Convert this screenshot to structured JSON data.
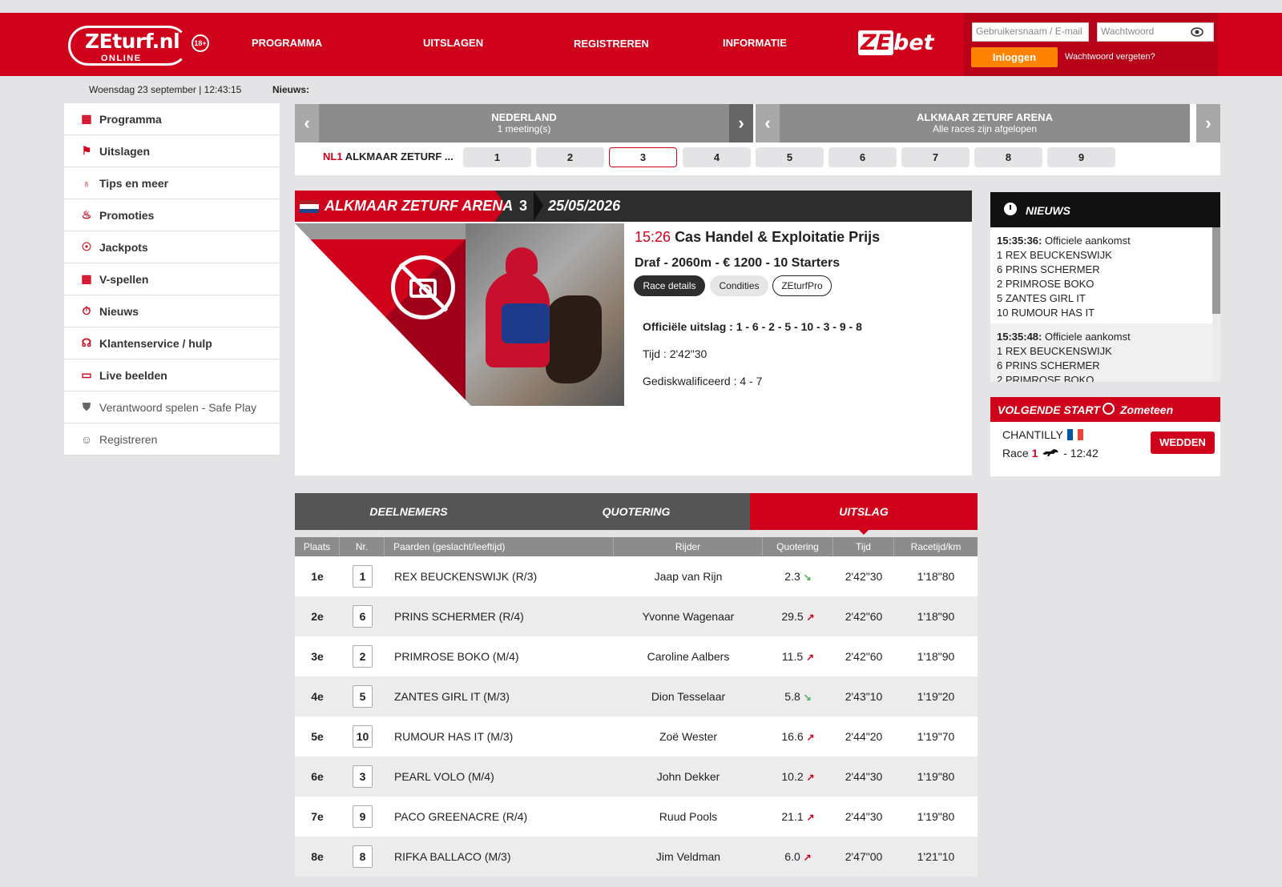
{
  "header": {
    "logo_text": "ZEturf.nl",
    "logo_sub": "ONLINE",
    "age": "18+",
    "nav": [
      "PROGRAMMA",
      "UITSLAGEN",
      "REGISTREREN",
      "INFORMATIE"
    ],
    "zebet_ze": "ZE",
    "zebet_bet": "bet",
    "login": {
      "username_placeholder": "Gebruikersnaam / E-mail",
      "password_placeholder": "Wachtwoord",
      "login_label": "Inloggen",
      "forgot_label": "Wachtwoord vergeten?"
    }
  },
  "datebar": {
    "date": "Woensdag 23 september | 12:43:15",
    "news_label": "Nieuws:"
  },
  "sidebar": {
    "items": [
      {
        "label": "Programma",
        "icon": "calendar-icon"
      },
      {
        "label": "Uitslagen",
        "icon": "flag-icon"
      },
      {
        "label": "Tips en meer",
        "icon": "bulb-icon"
      },
      {
        "label": "Promoties",
        "icon": "fire-icon"
      },
      {
        "label": "Jackpots",
        "icon": "money-bag-icon"
      },
      {
        "label": "V-spellen",
        "icon": "grid-icon"
      },
      {
        "label": "Nieuws",
        "icon": "stopwatch-icon"
      },
      {
        "label": "Klantenservice / hulp",
        "icon": "headset-icon"
      },
      {
        "label": "Live beelden",
        "icon": "monitor-icon"
      },
      {
        "label": "Verantwoord spelen - Safe Play",
        "icon": "shield-icon"
      },
      {
        "label": "Registreren",
        "icon": "user-icon"
      }
    ]
  },
  "meeting": {
    "country": "NEDERLAND",
    "country_sub": "1 meeting(s)",
    "venue": "ALKMAAR ZETURF ARENA",
    "venue_sub": "Alle races zijn afgelopen",
    "code": "NL1",
    "label": "ALKMAAR ZETURF ...",
    "races": [
      "1",
      "2",
      "3",
      "4",
      "5",
      "6",
      "7",
      "8",
      "9"
    ],
    "active_race": "3"
  },
  "race": {
    "venue": "ALKMAAR ZETURF ARENA",
    "number": "3",
    "date": "25/05/2026",
    "time": "15:26",
    "name": "Cas Handel & Exploitatie Prijs",
    "subtitle": "Draf - 2060m - € 1200 - 10 Starters",
    "buttons": [
      "Race details",
      "Condities",
      "ZEturfPro"
    ],
    "official": "Officiële uitslag : 1 - 6 - 2 - 5 - 10 - 3 - 9 - 8",
    "tijd": "Tijd : 2'42\"30",
    "dq": "Gediskwalificeerd : 4 - 7"
  },
  "tabs": [
    "DEELNEMERS",
    "QUOTERING",
    "UITSLAG"
  ],
  "table": {
    "headers": [
      "Plaats",
      "Nr.",
      "Paarden (geslacht/leeftijd)",
      "Rijder",
      "Quotering",
      "Tijd",
      "Racetijd/km"
    ],
    "rows": [
      {
        "plaats": "1e",
        "nr": "1",
        "paard": "REX BEUCKENSWIJK (R/3)",
        "rijder": "Jaap van Rijn",
        "quot": "2.3",
        "trend": "down",
        "tijd": "2'42\"30",
        "km": "1'18\"80"
      },
      {
        "plaats": "2e",
        "nr": "6",
        "paard": "PRINS SCHERMER (R/4)",
        "rijder": "Yvonne Wagenaar",
        "quot": "29.5",
        "trend": "up",
        "tijd": "2'42\"60",
        "km": "1'18\"90"
      },
      {
        "plaats": "3e",
        "nr": "2",
        "paard": "PRIMROSE BOKO (M/4)",
        "rijder": "Caroline Aalbers",
        "quot": "11.5",
        "trend": "up",
        "tijd": "2'42\"60",
        "km": "1'18\"90"
      },
      {
        "plaats": "4e",
        "nr": "5",
        "paard": "ZANTES GIRL IT (M/3)",
        "rijder": "Dion Tesselaar",
        "quot": "5.8",
        "trend": "down",
        "tijd": "2'43\"10",
        "km": "1'19\"20"
      },
      {
        "plaats": "5e",
        "nr": "10",
        "paard": "RUMOUR HAS IT (M/3)",
        "rijder": "Zoë Wester",
        "quot": "16.6",
        "trend": "up",
        "tijd": "2'44\"20",
        "km": "1'19\"70"
      },
      {
        "plaats": "6e",
        "nr": "3",
        "paard": "PEARL VOLO (M/4)",
        "rijder": "John Dekker",
        "quot": "10.2",
        "trend": "up",
        "tijd": "2'44\"30",
        "km": "1'19\"80"
      },
      {
        "plaats": "7e",
        "nr": "9",
        "paard": "PACO GREENACRE (R/4)",
        "rijder": "Ruud Pools",
        "quot": "21.1",
        "trend": "up",
        "tijd": "2'44\"30",
        "km": "1'19\"80"
      },
      {
        "plaats": "8e",
        "nr": "8",
        "paard": "RIFKA BALLACO (M/3)",
        "rijder": "Jim Veldman",
        "quot": "6.0",
        "trend": "up",
        "tijd": "2'47\"00",
        "km": "1'21\"10"
      }
    ]
  },
  "news": {
    "title": "NIEUWS",
    "entries": [
      {
        "time": "15:35:36:",
        "text": "Officiele aankomst",
        "lines": [
          "1 REX BEUCKENSWIJK",
          "6 PRINS SCHERMER",
          "2 PRIMROSE BOKO",
          "5 ZANTES GIRL IT",
          "10 RUMOUR HAS IT"
        ]
      },
      {
        "time": "15:35:48:",
        "text": "Officiele aankomst",
        "lines": [
          "1 REX BEUCKENSWIJK",
          "6 PRINS SCHERMER",
          "2 PRIMROSE BOKO"
        ]
      }
    ]
  },
  "next": {
    "title": "VOLGENDE START",
    "when": "Zometeen",
    "venue": "CHANTILLY",
    "race_label": "Race",
    "race_num": "1",
    "time": "- 12:42",
    "button": "WEDDEN"
  },
  "colors": {
    "brand_red": "#d0021b",
    "login_orange": "#ff8200",
    "dark": "#2d2d2d"
  }
}
